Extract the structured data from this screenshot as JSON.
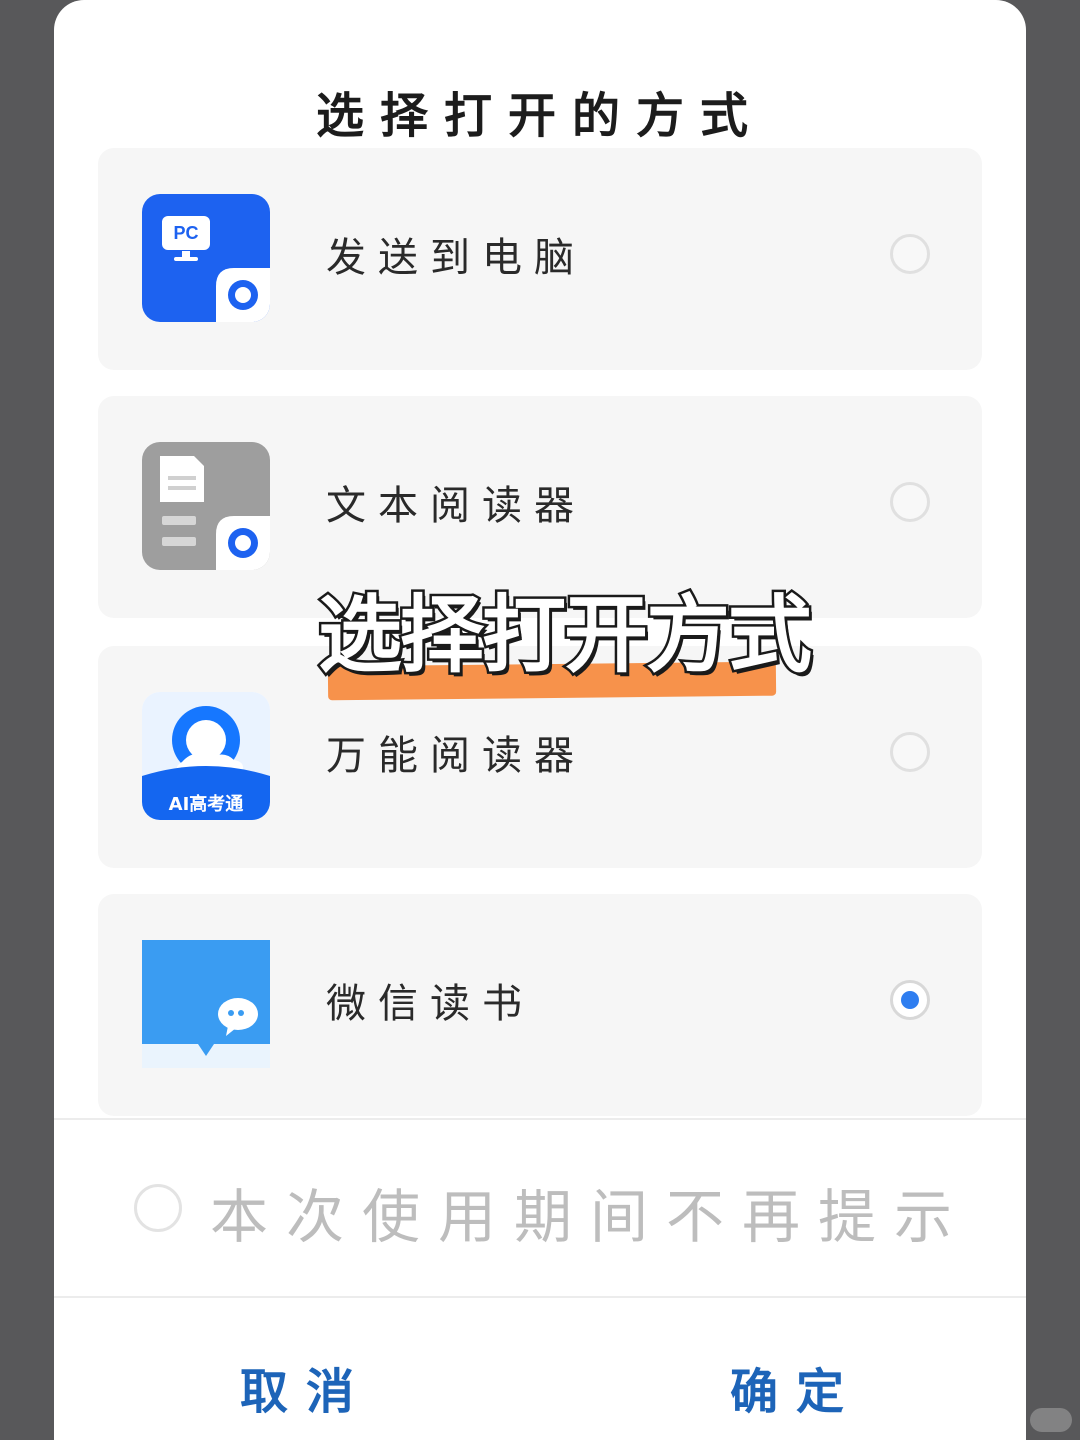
{
  "dialog": {
    "title": "选择打开的方式",
    "options": [
      {
        "label": "发送到电脑",
        "icon": "pc-transfer-icon",
        "icon_badge": "PC",
        "selected": false
      },
      {
        "label": "文本阅读器",
        "icon": "text-reader-icon",
        "selected": false
      },
      {
        "label": "万能阅读器",
        "icon": "universal-reader-icon",
        "icon_badge": "AI高考通",
        "selected": false
      },
      {
        "label": "微信读书",
        "icon": "wechat-read-icon",
        "selected": true
      }
    ],
    "remember": {
      "label": "本次使用期间不再提示",
      "checked": false
    },
    "cancel_label": "取消",
    "confirm_label": "确定"
  },
  "overlay": {
    "caption": "选择打开方式",
    "highlight_color": "#f7924b"
  },
  "colors": {
    "accent": "#2f7ef0",
    "button_text": "#1d64b8",
    "backdrop": "#58585a"
  }
}
